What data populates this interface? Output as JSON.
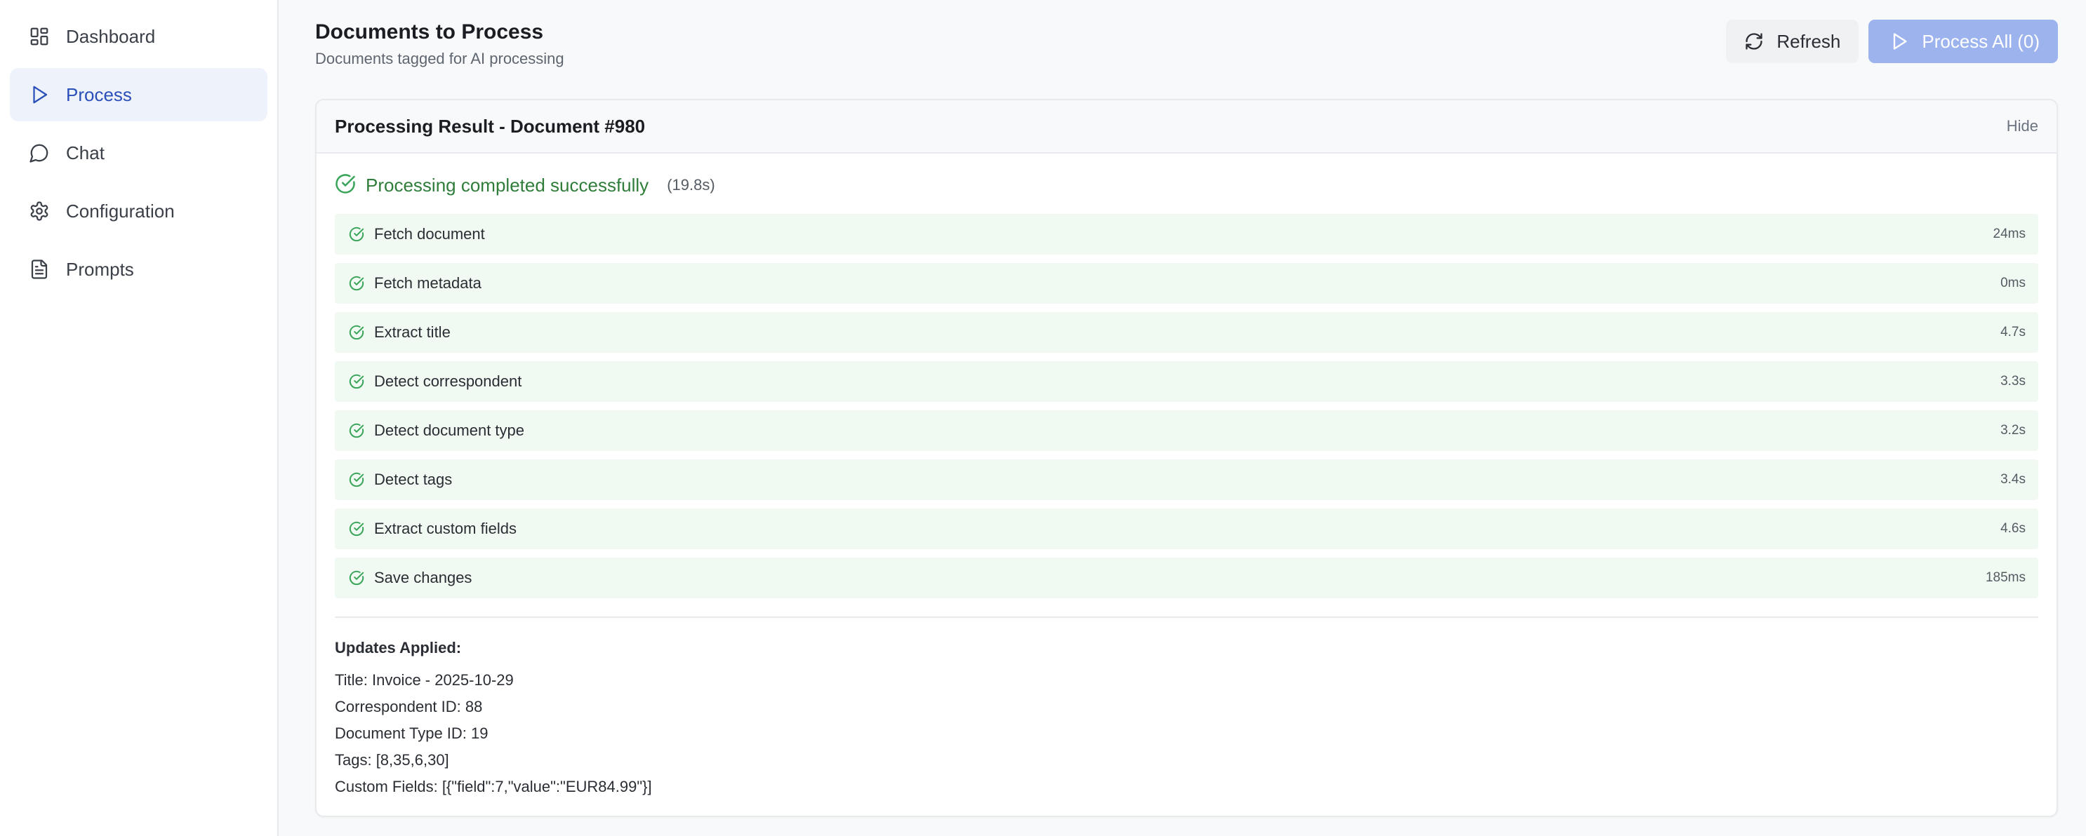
{
  "sidebar": {
    "items": [
      {
        "label": "Dashboard",
        "icon": "dashboard-icon",
        "active": false
      },
      {
        "label": "Process",
        "icon": "play-icon",
        "active": true
      },
      {
        "label": "Chat",
        "icon": "chat-bubble-icon",
        "active": false
      },
      {
        "label": "Configuration",
        "icon": "gear-icon",
        "active": false
      },
      {
        "label": "Prompts",
        "icon": "document-icon",
        "active": false
      }
    ]
  },
  "header": {
    "title": "Documents to Process",
    "subtitle": "Documents tagged for AI processing",
    "refresh_label": "Refresh",
    "process_all_label": "Process All (0)"
  },
  "result": {
    "title": "Processing Result - Document #980",
    "hide_label": "Hide",
    "status_text": "Processing completed successfully",
    "duration": "(19.8s)",
    "steps": [
      {
        "label": "Fetch document",
        "time": "24ms"
      },
      {
        "label": "Fetch metadata",
        "time": "0ms"
      },
      {
        "label": "Extract title",
        "time": "4.7s"
      },
      {
        "label": "Detect correspondent",
        "time": "3.3s"
      },
      {
        "label": "Detect document type",
        "time": "3.2s"
      },
      {
        "label": "Detect tags",
        "time": "3.4s"
      },
      {
        "label": "Extract custom fields",
        "time": "4.6s"
      },
      {
        "label": "Save changes",
        "time": "185ms"
      }
    ],
    "updates_title": "Updates Applied:",
    "updates": [
      "Title: Invoice - 2025-10-29",
      "Correspondent ID: 88",
      "Document Type ID: 19",
      "Tags: [8,35,6,30]",
      "Custom Fields: [{\"field\":7,\"value\":\"EUR84.99\"}]"
    ]
  },
  "colors": {
    "accent": "#2b4fb8",
    "active_bg": "#eef2fb",
    "success": "#2f7d3a",
    "success_icon": "#3aa55a",
    "step_bg": "#f1faf2",
    "process_button": "#9db3ee"
  }
}
